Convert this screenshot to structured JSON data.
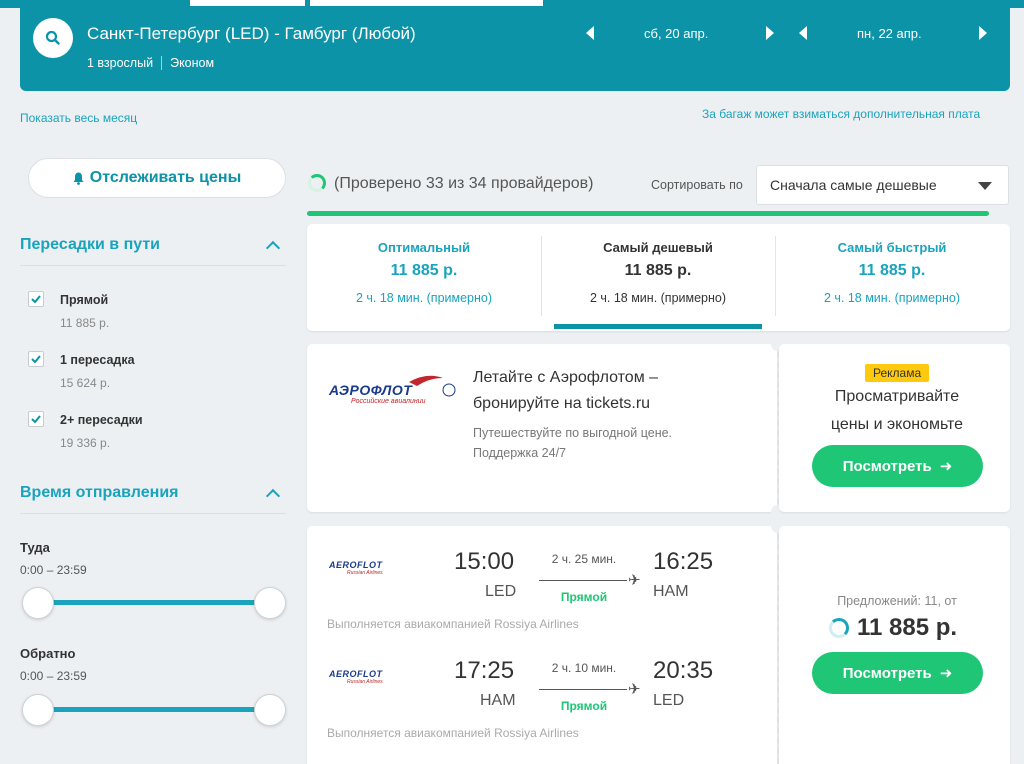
{
  "header": {
    "route": "Санкт-Петербург (LED) - Гамбург (Любой)",
    "passengers": "1 взрослый",
    "cabin": "Эконом",
    "depart_date": "сб, 20 апр.",
    "return_date": "пн, 22 апр."
  },
  "links": {
    "show_month": "Показать весь месяц",
    "baggage_note": "За багаж может взиматься дополнительная плата"
  },
  "sidebar": {
    "track_button": "Отслеживать цены",
    "stops_title": "Пересадки в пути",
    "stops": [
      {
        "label": "Прямой",
        "price": "11 885 р."
      },
      {
        "label": "1 пересадка",
        "price": "15 624 р."
      },
      {
        "label": "2+ пересадки",
        "price": "19 336 р."
      }
    ],
    "departure_title": "Время отправления",
    "outbound_label": "Туда",
    "outbound_range": "0:00 – 23:59",
    "return_label": "Обратно",
    "return_range": "0:00 – 23:59"
  },
  "status": {
    "checked": "(Проверено 33 из 34 провайдеров)",
    "sort_label": "Сортировать по",
    "sort_value": "Сначала самые дешевые",
    "progress_fraction": 0.97
  },
  "tabs": [
    {
      "title": "Оптимальный",
      "price": "11 885 р.",
      "duration": "2 ч. 18 мин. (примерно)"
    },
    {
      "title": "Самый дешевый",
      "price": "11 885 р.",
      "duration": "2 ч. 18 мин. (примерно)"
    },
    {
      "title": "Самый быстрый",
      "price": "11 885 р.",
      "duration": "2 ч. 18 мин. (примерно)"
    }
  ],
  "ad": {
    "logo_word": "АЭРОФЛОТ",
    "logo_sub": "Российские авиалинии",
    "title_line1": "Летайте с Аэрофлотом –",
    "title_line2": "бронируйте на tickets.ru",
    "sub_line1": "Путешествуйте по выгодной цене.",
    "sub_line2": "Поддержка 24/7",
    "badge": "Реклама",
    "right_line1": "Просматривайте",
    "right_line2": "цены и экономьте",
    "button": "Посмотреть"
  },
  "result": {
    "logo_word": "AEROFLOT",
    "logo_sub": "Russian Airlines",
    "legs": [
      {
        "dep_time": "15:00",
        "dep_code": "LED",
        "duration": "2 ч. 25 мин.",
        "stops": "Прямой",
        "arr_time": "16:25",
        "arr_code": "HAM",
        "operated": "Выполняется авиакомпанией Rossiya Airlines"
      },
      {
        "dep_time": "17:25",
        "dep_code": "HAM",
        "duration": "2 ч. 10 мин.",
        "stops": "Прямой",
        "arr_time": "20:35",
        "arr_code": "LED",
        "operated": "Выполняется авиакомпанией Rossiya Airlines"
      }
    ],
    "offers": "Предложений: 11, от",
    "price": "11 885 р.",
    "button": "Посмотреть"
  },
  "colors": {
    "accent": "#0d93a8",
    "link": "#1aa3bd",
    "green": "#1fc675",
    "badge": "#ffc90e"
  }
}
